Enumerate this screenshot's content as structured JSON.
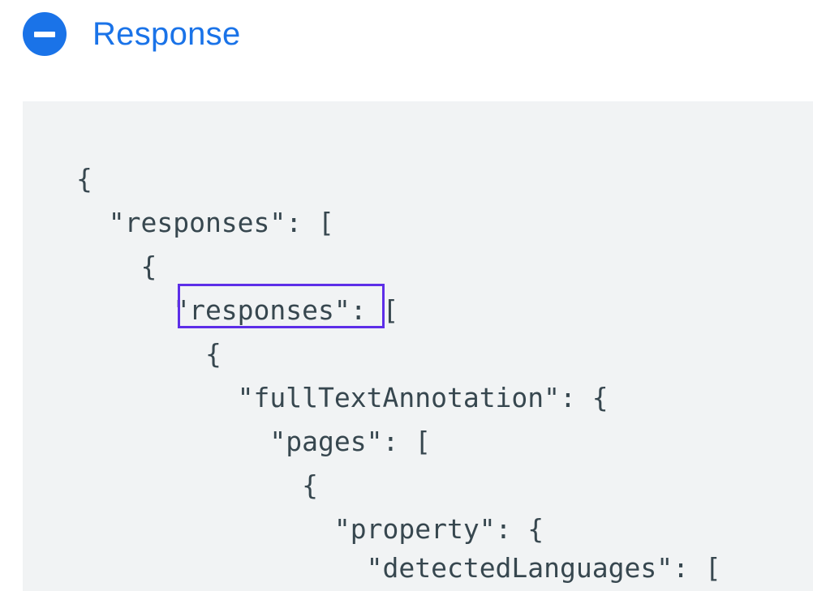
{
  "header": {
    "icon": "minus-circle-icon",
    "title": "Response",
    "accent_color": "#1a73e8"
  },
  "code": {
    "background": "#f1f3f4",
    "text_color": "#37474f",
    "highlight_color": "#5d2ee8",
    "lines": [
      "{",
      "  \"responses\": [",
      "    {",
      "      \"responses\": [",
      "        {",
      "          \"fullTextAnnotation\": {",
      "            \"pages\": [",
      "              {",
      "                \"property\": {",
      "                  \"detectedLanguages\": ["
    ]
  }
}
